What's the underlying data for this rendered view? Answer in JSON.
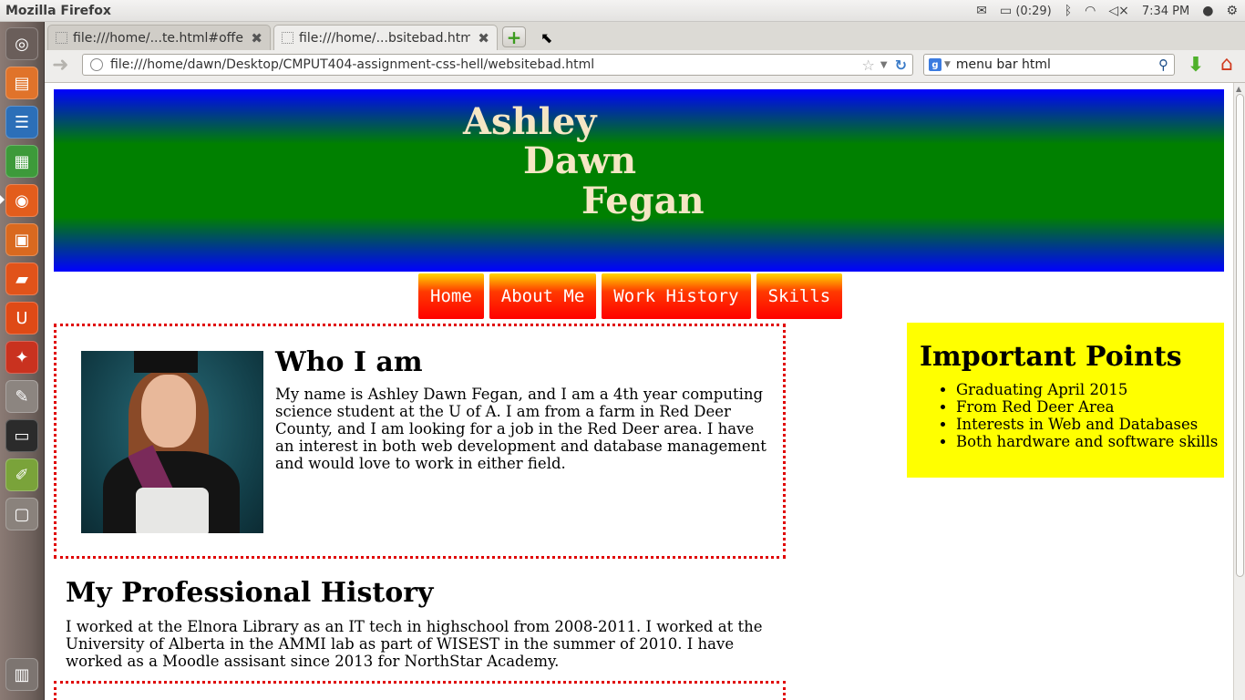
{
  "os": {
    "app_title": "Mozilla Firefox",
    "battery": "(0:29)",
    "clock": "7:34 PM"
  },
  "browser": {
    "tabs": [
      {
        "label": "file:///home/...te.html#offer"
      },
      {
        "label": "file:///home/...bsitebad.html"
      }
    ],
    "url": "file:///home/dawn/Desktop/CMPUT404-assignment-css-hell/websitebad.html",
    "search_value": "menu bar html"
  },
  "page": {
    "header": {
      "line1": "Ashley",
      "line2": "Dawn",
      "line3": "Fegan"
    },
    "menu": [
      {
        "label": "Home"
      },
      {
        "label": "About Me"
      },
      {
        "label": "Work History"
      },
      {
        "label": "Skills"
      }
    ],
    "who": {
      "title": "Who I am",
      "text": "My name is Ashley Dawn Fegan, and I am a 4th year computing science student at the U of A. I am from a farm in Red Deer County, and I am looking for a job in the Red Deer area. I have an interest in both web development and database management and would love to work in either field."
    },
    "points": {
      "title": "Important Points",
      "items": [
        "Graduating April 2015",
        "From Red Deer Area",
        "Interests in Web and Databases",
        "Both hardware and software skills"
      ]
    },
    "history": {
      "title": "My Professional History",
      "text": "I worked at the Elnora Library as an IT tech in highschool from 2008-2011. I worked at the University of Alberta in the AMMI lab as part of WISEST in the summer of 2010. I have worked as a Moodle assisant since 2013 for NorthStar Academy."
    }
  }
}
